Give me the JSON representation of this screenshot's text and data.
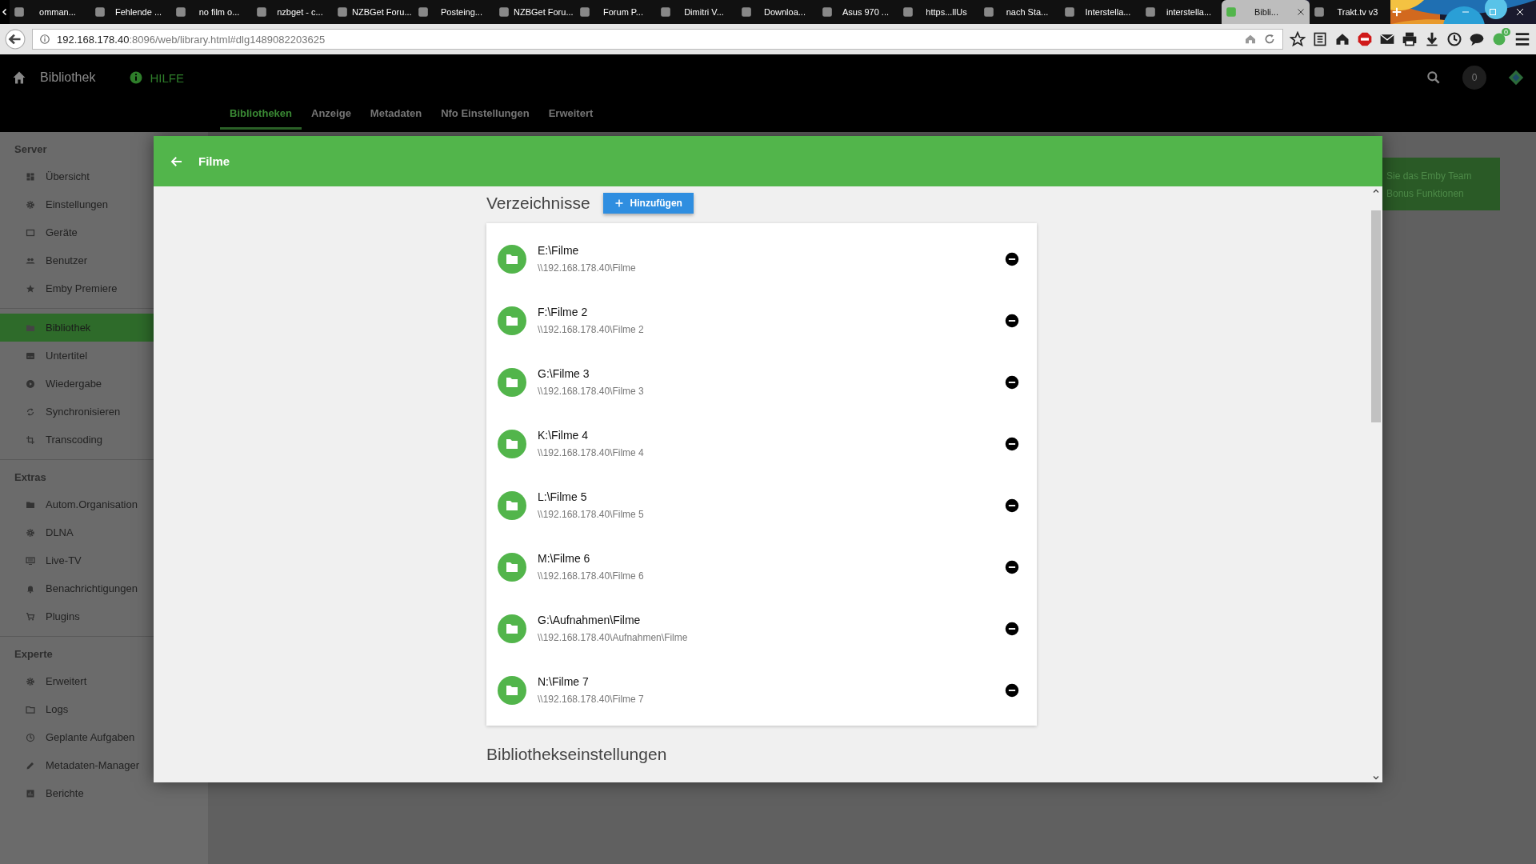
{
  "browser": {
    "tabs": [
      {
        "title": "omman...",
        "selected": false
      },
      {
        "title": "Fehlende ...",
        "selected": false
      },
      {
        "title": "no film o...",
        "selected": false
      },
      {
        "title": "nzbget - c...",
        "selected": false
      },
      {
        "title": "NZBGet Foru...",
        "selected": false
      },
      {
        "title": "Posteing...",
        "selected": false
      },
      {
        "title": "NZBGet Foru...",
        "selected": false
      },
      {
        "title": "Forum P...",
        "selected": false
      },
      {
        "title": "Dimitri V...",
        "selected": false
      },
      {
        "title": "Downloa...",
        "selected": false
      },
      {
        "title": "Asus 970 ...",
        "selected": false
      },
      {
        "title": "https...llUs",
        "selected": false
      },
      {
        "title": "nach Sta...",
        "selected": false
      },
      {
        "title": "Interstella...",
        "selected": false
      },
      {
        "title": "interstella...",
        "selected": false
      },
      {
        "title": "Bibli...",
        "selected": true
      },
      {
        "title": "Trakt.tv v3",
        "selected": false
      }
    ],
    "url_host": "192.168.178.40",
    "url_path": ":8096/web/library.html#dlg1489082203625",
    "addon_badge": "0"
  },
  "header": {
    "title": "Bibliothek",
    "help": "HILFE",
    "notification_count": "0",
    "tabs": [
      {
        "label": "Bibliotheken",
        "selected": true
      },
      {
        "label": "Anzeige",
        "selected": false
      },
      {
        "label": "Metadaten",
        "selected": false
      },
      {
        "label": "Nfo Einstellungen",
        "selected": false
      },
      {
        "label": "Erweitert",
        "selected": false
      }
    ]
  },
  "sidebar": {
    "sections": [
      {
        "heading": "Server",
        "items": [
          {
            "label": "Übersicht",
            "selected": false
          },
          {
            "label": "Einstellungen",
            "selected": false
          },
          {
            "label": "Geräte",
            "selected": false
          },
          {
            "label": "Benutzer",
            "selected": false
          },
          {
            "label": "Emby Premiere",
            "selected": false
          }
        ]
      },
      {
        "items": [
          {
            "label": "Bibliothek",
            "selected": true
          },
          {
            "label": "Untertitel",
            "selected": false
          },
          {
            "label": "Wiedergabe",
            "selected": false
          },
          {
            "label": "Synchronisieren",
            "selected": false
          },
          {
            "label": "Transcoding",
            "selected": false
          }
        ]
      },
      {
        "heading": "Extras",
        "items": [
          {
            "label": "Autom.Organisation",
            "selected": false
          },
          {
            "label": "DLNA",
            "selected": false
          },
          {
            "label": "Live-TV",
            "selected": false
          },
          {
            "label": "Benachrichtigungen",
            "selected": false
          },
          {
            "label": "Plugins",
            "selected": false
          }
        ]
      },
      {
        "heading": "Experte",
        "items": [
          {
            "label": "Erweitert",
            "selected": false
          },
          {
            "label": "Logs",
            "selected": false
          },
          {
            "label": "Geplante Aufgaben",
            "selected": false
          },
          {
            "label": "Metadaten-Manager",
            "selected": false
          },
          {
            "label": "Berichte",
            "selected": false
          }
        ]
      }
    ]
  },
  "promo": {
    "lines": [
      "Sie das Emby Team",
      "Bonus Funktionen"
    ]
  },
  "dialog": {
    "title": "Filme",
    "folders_heading": "Verzeichnisse",
    "add_button": "Hinzufügen",
    "folders": [
      {
        "title": "E:\\Filme",
        "path": "\\\\192.168.178.40\\Filme"
      },
      {
        "title": "F:\\Filme 2",
        "path": "\\\\192.168.178.40\\Filme 2"
      },
      {
        "title": "G:\\Filme 3",
        "path": "\\\\192.168.178.40\\Filme 3"
      },
      {
        "title": "K:\\Filme 4",
        "path": "\\\\192.168.178.40\\Filme 4"
      },
      {
        "title": "L:\\Filme 5",
        "path": "\\\\192.168.178.40\\Filme 5"
      },
      {
        "title": "M:\\Filme 6",
        "path": "\\\\192.168.178.40\\Filme 6"
      },
      {
        "title": "G:\\Aufnahmen\\Filme",
        "path": "\\\\192.168.178.40\\Aufnahmen\\Filme"
      },
      {
        "title": "N:\\Filme 7",
        "path": "\\\\192.168.178.40\\Filme 7"
      }
    ],
    "settings_heading": "Bibliothekseinstellungen"
  }
}
